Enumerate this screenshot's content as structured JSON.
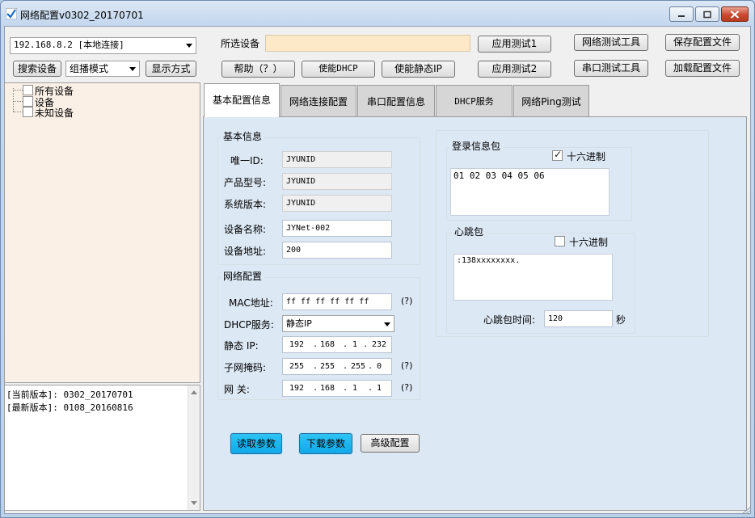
{
  "window": {
    "title": "网络配置v0302_20170701"
  },
  "toolbar": {
    "network_select": "192.168.8.2  [本地连接]",
    "search_button": "搜索设备",
    "mode_select": "组播模式",
    "display_button": "显示方式",
    "selected_device_label": "所选设备",
    "selected_device_value": "",
    "help_button": "帮助（？）",
    "enable_dhcp_button": "使能DHCP",
    "enable_static_ip_button": "使能静态IP",
    "app_test1_button": "应用测试1",
    "app_test2_button": "应用测试2",
    "net_test_tool_button": "网络测试工具",
    "serial_test_tool_button": "串口测试工具",
    "save_config_button": "保存配置文件",
    "load_config_button": "加载配置文件"
  },
  "tree": {
    "items": [
      "所有设备",
      "设备",
      "未知设备"
    ]
  },
  "log": {
    "lines": [
      "[当前版本]: 0302_20170701",
      "[最新版本]: 0108_20160816"
    ]
  },
  "tabs": [
    "基本配置信息",
    "网络连接配置",
    "串口配置信息",
    "DHCP服务",
    "网络Ping测试"
  ],
  "basic_info": {
    "group_title": "基本信息",
    "unique_id_label": "唯一ID:",
    "unique_id_value": "JYUNID",
    "model_label": "产品型号:",
    "model_value": "JYUNID",
    "version_label": "系统版本:",
    "version_value": "JYUNID",
    "device_name_label": "设备名称:",
    "device_name_value": "JYNet-002",
    "device_addr_label": "设备地址:",
    "device_addr_value": "200"
  },
  "network": {
    "group_title": "网络配置",
    "mac_label": "MAC地址:",
    "mac_value": "ff ff ff ff ff ff",
    "mac_hint": "(?)",
    "dhcp_label": "DHCP服务:",
    "dhcp_value": "静态IP",
    "static_ip_label": "静态  IP:",
    "static_ip": [
      "192",
      "168",
      "1",
      "232"
    ],
    "subnet_label": "子网掩码:",
    "subnet": [
      "255",
      "255",
      "255",
      "0"
    ],
    "subnet_hint": "(?)",
    "gateway_label": "网    关:",
    "gateway": [
      "192",
      "168",
      "1",
      "1"
    ],
    "gateway_hint": "(?)"
  },
  "buttons": {
    "read_params": "读取参数",
    "download_params": "下载参数",
    "advanced": "高级配置"
  },
  "login_packet": {
    "group_title": "登录信息包",
    "hex_label": "十六进制",
    "hex_checked": true,
    "content": "01 02 03 04 05 06"
  },
  "heartbeat": {
    "group_title": "心跳包",
    "hex_label": "十六进制",
    "hex_checked": false,
    "content": ":138xxxxxxxx.",
    "interval_label": "心跳包时间:",
    "interval_value": "120",
    "interval_unit": "秒"
  }
}
